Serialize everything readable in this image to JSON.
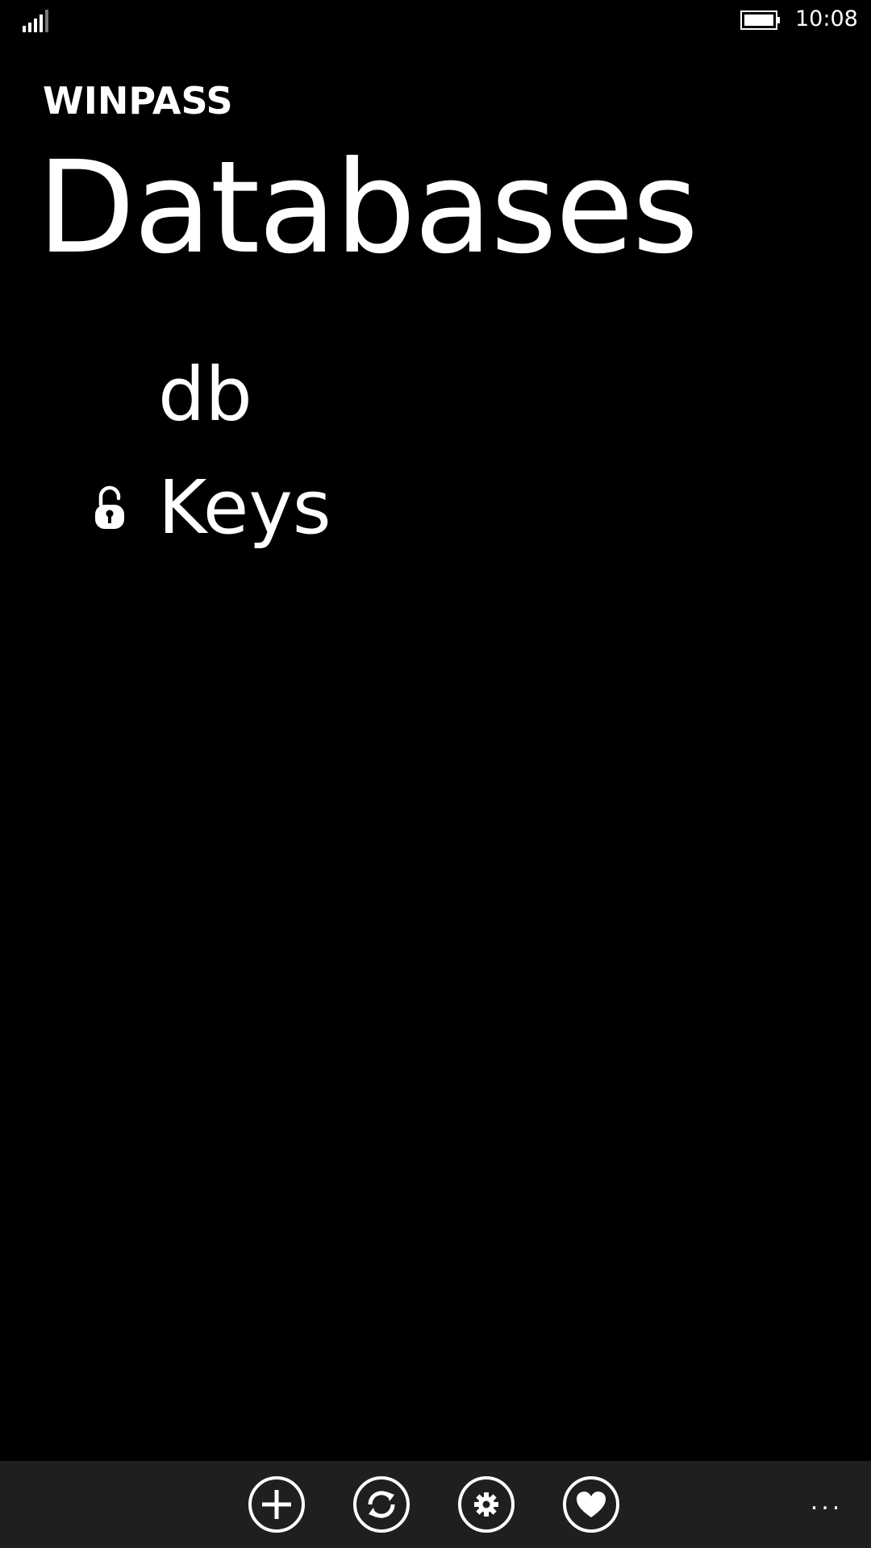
{
  "status_bar": {
    "time": "10:08",
    "signal_icon": "signal-strength-icon",
    "battery_icon": "battery-icon"
  },
  "header": {
    "app_title": "WINPASS",
    "page_title": "Databases"
  },
  "databases": [
    {
      "name": "db",
      "locked": true,
      "icon": null
    },
    {
      "name": "Keys",
      "locked": false,
      "icon": "unlocked-padlock-icon"
    }
  ],
  "app_bar": {
    "buttons": [
      {
        "name": "add-button",
        "icon": "plus-icon"
      },
      {
        "name": "sync-button",
        "icon": "sync-icon"
      },
      {
        "name": "settings-button",
        "icon": "gear-icon"
      },
      {
        "name": "favorite-button",
        "icon": "heart-icon"
      }
    ],
    "more_label": "..."
  },
  "colors": {
    "background": "#000000",
    "foreground": "#ffffff",
    "app_bar_background": "#1f1f1f"
  }
}
